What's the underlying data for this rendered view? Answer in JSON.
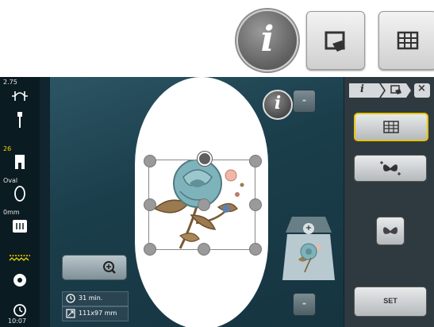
{
  "top_buttons": {
    "info_glyph": "i",
    "move_icon": "move-hoop-icon",
    "grid_icon": "grid-icon"
  },
  "sidebar": {
    "thread_tension": "2.75",
    "presser_foot": "26",
    "hoop": "Oval",
    "needle_offset": "0mm",
    "time": "10:07"
  },
  "workspace": {
    "info_glyph": "i",
    "up_arrow": "-",
    "down_arrow": "-",
    "layer_add": "+",
    "stitch_time": "31 min.",
    "design_size": "111x97 mm"
  },
  "right_panel": {
    "tab_info": "i",
    "close_label": "×",
    "set_label": "SET"
  },
  "colors": {
    "screen_bg": "#10252e",
    "accent_yellow": "#e7c400",
    "rose_blue": "#7fb3bb",
    "leaf_brown": "#9a7a4e"
  }
}
